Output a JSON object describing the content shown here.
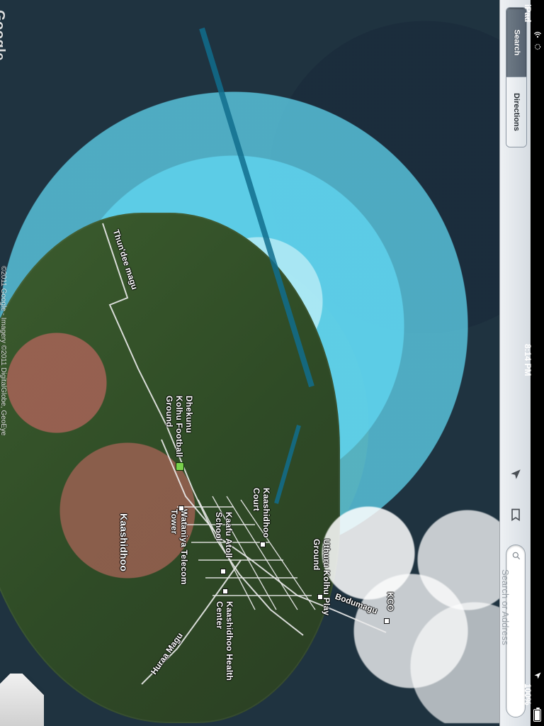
{
  "map": {
    "logo": "Google",
    "attribution": "©2011 Google - Imagery ©2011 DigitalGlobe, GeoEye",
    "labels": [
      {
        "text": "Thun'dee magu",
        "kind": "road"
      },
      {
        "text": "Dhekunu Kolhu Football Ground",
        "kind": "poi"
      },
      {
        "text": "Kaashidhoo",
        "kind": "place"
      },
      {
        "text": "Wataniya Telecom Tower",
        "kind": "poi"
      },
      {
        "text": "Kaashidhoo Court",
        "kind": "poi"
      },
      {
        "text": "Kaafu Atoll School",
        "kind": "poi"
      },
      {
        "text": "Kaashidhoo Health Center",
        "kind": "poi"
      },
      {
        "text": "Uthuru Kolhu Play Ground",
        "kind": "poi"
      },
      {
        "text": "Bodumagu",
        "kind": "road"
      },
      {
        "text": "KCO",
        "kind": "poi"
      },
      {
        "text": "Huraa Magu",
        "kind": "road"
      }
    ]
  },
  "toolbar": {
    "tabs": [
      {
        "label": "Search",
        "active": true
      },
      {
        "label": "Directions",
        "active": false
      }
    ],
    "icons": {
      "locate": "location-arrow-icon",
      "bookmarks": "bookmark-icon",
      "search": "search-icon"
    },
    "search": {
      "placeholder": "Search or Address",
      "value": ""
    }
  },
  "status_bar": {
    "carrier": "iPad",
    "time": "8:14 PM",
    "battery_text": "100%",
    "battery_level": 1.0
  },
  "colors": {
    "toolbar_bg": "#e2e7ec",
    "active_tab": "#5f6b78",
    "label_text": "#ffffff"
  }
}
